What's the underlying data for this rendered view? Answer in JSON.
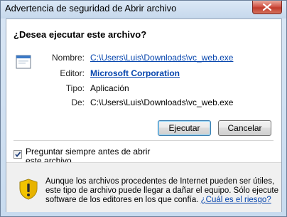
{
  "window": {
    "title": "Advertencia de seguridad de Abrir archivo"
  },
  "dialog": {
    "question": "¿Desea ejecutar este archivo?",
    "fields": [
      {
        "label": "Nombre:",
        "value": "C:\\Users\\Luis\\Downloads\\vc_web.exe"
      },
      {
        "label": "Editor:",
        "value": "Microsoft Corporation"
      },
      {
        "label": "Tipo:",
        "value": "Aplicación"
      },
      {
        "label": "De:",
        "value": "C:\\Users\\Luis\\Downloads\\vc_web.exe"
      }
    ],
    "run_button": "Ejecutar",
    "cancel_button": "Cancelar",
    "checkbox_label": "Preguntar siempre antes de abrir este archivo",
    "checkbox_checked": true,
    "warning_text": "Aunque los archivos procedentes de Internet pueden ser útiles, este tipo de archivo puede llegar a dañar el equipo. Sólo ejecute software de los editores en los que confía.",
    "risk_link": "¿Cuál es el riesgo?"
  },
  "icons": {
    "close": "close-icon",
    "file": "application-icon",
    "shield": "security-shield-icon",
    "check": "check-icon"
  },
  "colors": {
    "link": "#0645ad",
    "close_button": "#c13b2b",
    "shield_yellow": "#f2c400"
  }
}
